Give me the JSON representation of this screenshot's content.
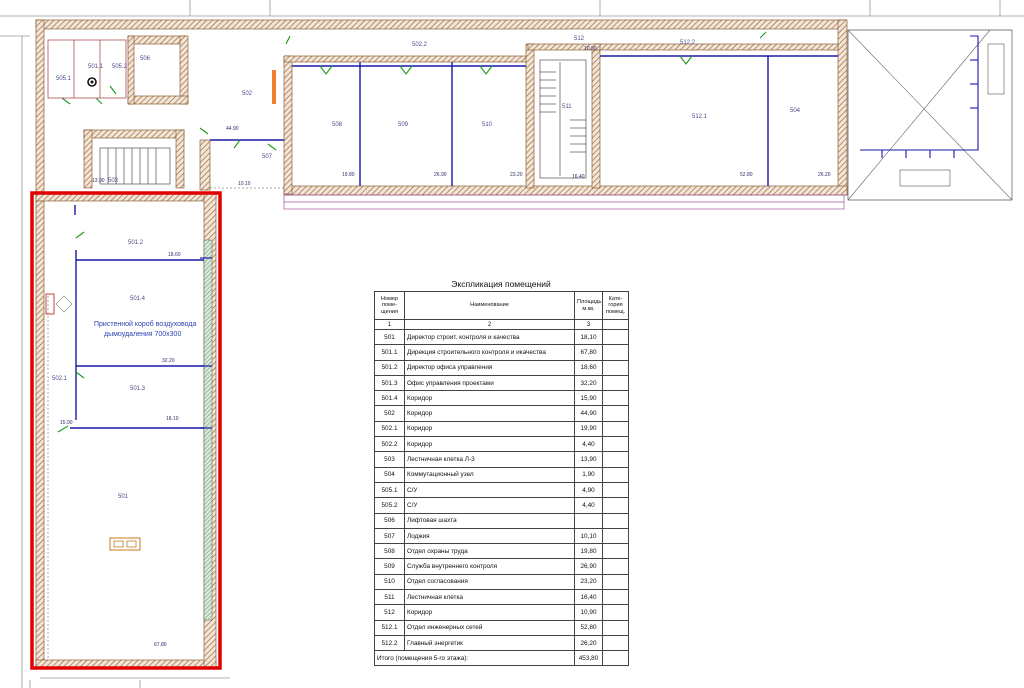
{
  "plan": {
    "highlight_color": "#e00000",
    "wall_color": "#8b5a2b",
    "partition_color": "#1a1aa8",
    "note": [
      "Пристенной короб воздуховода",
      "дымоудаления 700x300"
    ],
    "rooms": [
      {
        "id": "r505_1",
        "label": "505.1"
      },
      {
        "id": "r505_2",
        "label": "505.2"
      },
      {
        "id": "r506",
        "label": "506"
      },
      {
        "id": "r502",
        "label": "502"
      },
      {
        "id": "r507",
        "label": "507"
      },
      {
        "id": "r503",
        "label": "503"
      },
      {
        "id": "r508",
        "label": "508"
      },
      {
        "id": "r509",
        "label": "509"
      },
      {
        "id": "r510",
        "label": "510"
      },
      {
        "id": "r511",
        "label": "511"
      },
      {
        "id": "r512",
        "label": "512"
      },
      {
        "id": "r502_2",
        "label": "502.2"
      },
      {
        "id": "r512_2",
        "label": "512.2"
      },
      {
        "id": "r512_1",
        "label": "512.1"
      },
      {
        "id": "r504",
        "label": "504"
      },
      {
        "id": "r502_1",
        "label": "502.1"
      },
      {
        "id": "r501_2",
        "label": "501.2"
      },
      {
        "id": "r501_4",
        "label": "501.4"
      },
      {
        "id": "r501_3",
        "label": "501.3"
      },
      {
        "id": "r501",
        "label": "501"
      },
      {
        "id": "r501_1",
        "label": "501.1"
      }
    ],
    "dims": [
      "44.90",
      "10.10",
      "13.90",
      "19.80",
      "26.90",
      "23.20",
      "16.40",
      "10.90",
      "52.80",
      "26.20",
      "18.60",
      "32.20",
      "15.90",
      "18.10",
      "67.80"
    ]
  },
  "explication": {
    "title": "Экспликация помещений",
    "headers": [
      "Номер поме-щения",
      "Наименование",
      "Площадь м.кв.",
      "Кате-гория помещ."
    ],
    "index_row": [
      "1",
      "2",
      "3",
      ""
    ],
    "rows": [
      {
        "num": "501",
        "name": "Директор строит. контроля и качества",
        "area": "18,10"
      },
      {
        "num": "501.1",
        "name": "Дирекция строительного контроля и икачества",
        "area": "67,80"
      },
      {
        "num": "501.2",
        "name": "Директор офиса управления",
        "area": "18,60"
      },
      {
        "num": "501.3",
        "name": "Офис управления проектами",
        "area": "32,20"
      },
      {
        "num": "501.4",
        "name": "Коридор",
        "area": "15,90"
      },
      {
        "num": "502",
        "name": "Коридор",
        "area": "44,90"
      },
      {
        "num": "502.1",
        "name": "Коридор",
        "area": "19,90"
      },
      {
        "num": "502.2",
        "name": "Коридор",
        "area": "4,40"
      },
      {
        "num": "503",
        "name": "Лестничная клетка Л-3",
        "area": "13,90"
      },
      {
        "num": "504",
        "name": "Коммутационный узел",
        "area": "1,90"
      },
      {
        "num": "505.1",
        "name": "С/У",
        "area": "4,90"
      },
      {
        "num": "505.2",
        "name": "С/У",
        "area": "4,40"
      },
      {
        "num": "506",
        "name": "Лифтовая шахта",
        "area": ""
      },
      {
        "num": "507",
        "name": "Лоджия",
        "area": "10,10"
      },
      {
        "num": "508",
        "name": "Отдел охраны труда",
        "area": "19,80"
      },
      {
        "num": "509",
        "name": "Служба внутреннего контроля",
        "area": "26,90"
      },
      {
        "num": "510",
        "name": "Отдел согласования",
        "area": "23,20"
      },
      {
        "num": "511",
        "name": "Лестничная клетка",
        "area": "16,40"
      },
      {
        "num": "512",
        "name": "Коридор",
        "area": "10,90"
      },
      {
        "num": "512.1",
        "name": "Отдел инженерных сетей",
        "area": "52,80"
      },
      {
        "num": "512.2",
        "name": "Главный энергетик",
        "area": "26,20"
      }
    ],
    "total_label": "Итого  (помещения 5-го этажа):",
    "total_area": "453,80"
  }
}
